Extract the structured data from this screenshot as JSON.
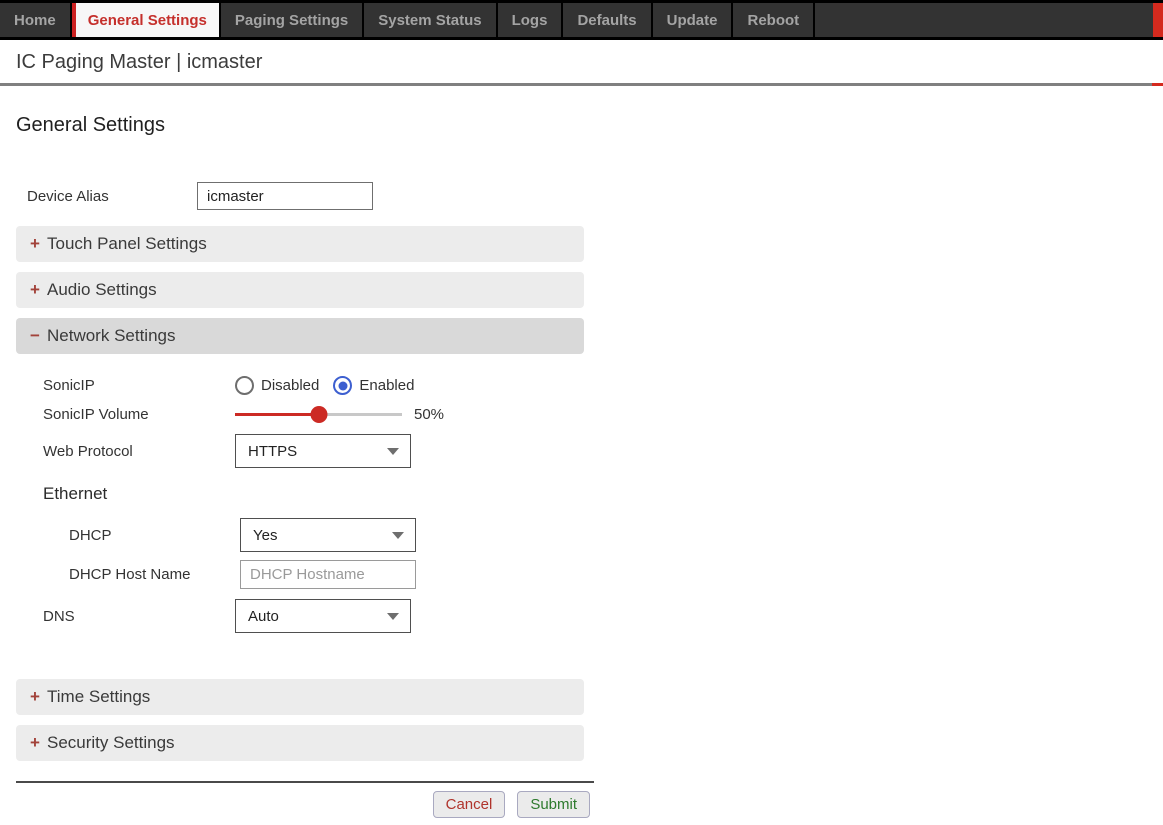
{
  "accent": {
    "red": "#cc2222",
    "blue": "#3d5fd0",
    "green": "#2d7a2d",
    "gray_rule": "#808080"
  },
  "nav": {
    "active_tab": "General Settings",
    "tabs": [
      {
        "label": "Home"
      },
      {
        "label": "General Settings"
      },
      {
        "label": "Paging Settings"
      },
      {
        "label": "System Status"
      },
      {
        "label": "Logs"
      },
      {
        "label": "Defaults"
      },
      {
        "label": "Update"
      },
      {
        "label": "Reboot"
      }
    ]
  },
  "header": {
    "title": "IC Paging Master | icmaster"
  },
  "page": {
    "heading": "General Settings"
  },
  "form": {
    "device_alias": {
      "label": "Device Alias",
      "value": "icmaster"
    },
    "accordions": {
      "touch_panel": {
        "icon": "+",
        "label": "Touch Panel Settings",
        "expanded": false
      },
      "audio": {
        "icon": "+",
        "label": "Audio Settings",
        "expanded": false
      },
      "network": {
        "icon": "−",
        "label": "Network Settings",
        "expanded": true
      },
      "time": {
        "icon": "+",
        "label": "Time Settings",
        "expanded": false
      },
      "security": {
        "icon": "+",
        "label": "Security Settings",
        "expanded": false
      }
    },
    "network": {
      "sonicip": {
        "label": "SonicIP",
        "options": [
          "Disabled",
          "Enabled"
        ],
        "selected": "Enabled"
      },
      "sonicip_volume": {
        "label": "SonicIP Volume",
        "value_percent": 50,
        "value_label": "50%"
      },
      "web_protocol": {
        "label": "Web Protocol",
        "value": "HTTPS"
      },
      "ethernet_heading": "Ethernet",
      "dhcp": {
        "label": "DHCP",
        "value": "Yes"
      },
      "dhcp_host_name": {
        "label": "DHCP Host Name",
        "value": "",
        "placeholder": "DHCP Hostname"
      },
      "dns": {
        "label": "DNS",
        "value": "Auto"
      }
    },
    "buttons": {
      "cancel": "Cancel",
      "submit": "Submit"
    }
  }
}
